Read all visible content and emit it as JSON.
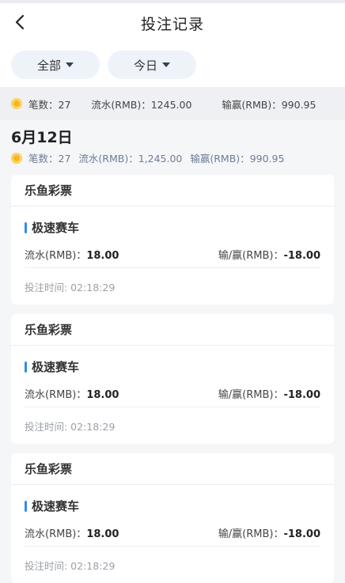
{
  "header": {
    "title": "投注记录"
  },
  "filters": [
    {
      "label": "全部"
    },
    {
      "label": "今日"
    }
  ],
  "summary": {
    "count_text": "笔数：27",
    "flow_text": "流水(RMB)：1245.00",
    "win_text": "输赢(RMB)：990.95"
  },
  "day": {
    "title": "6月12日",
    "count_text": "笔数：27",
    "flow_text": "流水(RMB)：1,245.00",
    "win_text": "输赢(RMB)：990.95"
  },
  "records": [
    {
      "lottery": "乐鱼彩票",
      "game": "极速赛车",
      "flow_label": "流水(RMB)：",
      "flow_value": "18.00",
      "win_label": "输/赢(RMB)：",
      "win_value": "-18.00",
      "time": "投注时间: 02:18:29"
    },
    {
      "lottery": "乐鱼彩票",
      "game": "极速赛车",
      "flow_label": "流水(RMB)：",
      "flow_value": "18.00",
      "win_label": "输/赢(RMB)：",
      "win_value": "-18.00",
      "time": "投注时间: 02:18:29"
    },
    {
      "lottery": "乐鱼彩票",
      "game": "极速赛车",
      "flow_label": "流水(RMB)：",
      "flow_value": "18.00",
      "win_label": "输/赢(RMB)：",
      "win_value": "-18.00",
      "time": "投注时间: 02:18:29"
    }
  ],
  "colors": {
    "accent": "#2f8ee8",
    "coin": "#f6b520",
    "pill_bg": "#eef3fa"
  },
  "icons": {
    "back": "chevron-left-icon",
    "coin": "coin-icon",
    "dropdown": "caret-down-icon"
  }
}
